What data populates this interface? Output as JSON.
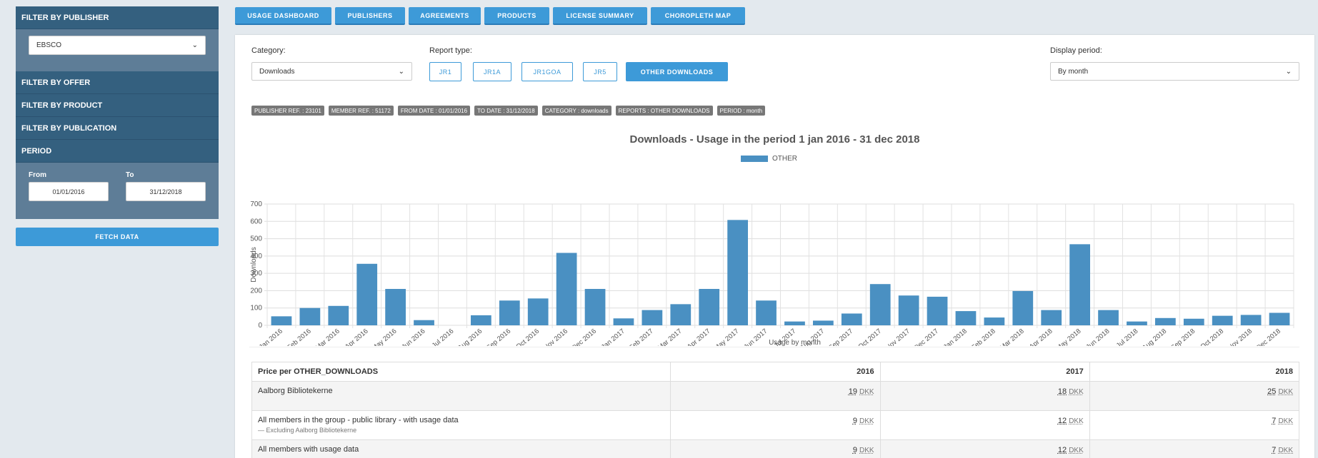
{
  "sidebar": {
    "filter_publisher": "FILTER BY PUBLISHER",
    "publisher_value": "EBSCO",
    "filter_offer": "FILTER BY OFFER",
    "filter_product": "FILTER BY PRODUCT",
    "filter_publication": "FILTER BY PUBLICATION",
    "period": "PERIOD",
    "from_label": "From",
    "to_label": "To",
    "from_value": "01/01/2016",
    "to_value": "31/12/2018",
    "fetch": "FETCH DATA"
  },
  "nav": [
    "USAGE DASHBOARD",
    "PUBLISHERS",
    "AGREEMENTS",
    "PRODUCTS",
    "LICENSE SUMMARY",
    "CHOROPLETH MAP"
  ],
  "controls": {
    "category_label": "Category:",
    "category_value": "Downloads",
    "report_label": "Report type:",
    "report_types": [
      "JR1",
      "JR1A",
      "JR1GOA",
      "JR5",
      "OTHER DOWNLOADS"
    ],
    "active_report": "OTHER DOWNLOADS",
    "period_label": "Display period:",
    "period_value": "By month"
  },
  "badges": [
    "PUBLISHER REF. : 23101",
    "MEMBER REF. : 51172",
    "FROM DATE : 01/01/2016",
    "TO DATE : 31/12/2018",
    "CATEGORY : downloads",
    "REPORTS : OTHER DOWNLOADS",
    "PERIOD : month"
  ],
  "chart_data": {
    "type": "bar",
    "title": "Downloads - Usage in the period 1 jan 2016 - 31 dec 2018",
    "xlabel": "Usage by month",
    "ylabel": "Downloads",
    "ylim": [
      0,
      700
    ],
    "yticks": [
      0,
      100,
      200,
      300,
      400,
      500,
      600,
      700
    ],
    "grid": true,
    "legend_position": "top-center",
    "color": "#4a90c2",
    "categories": [
      "Jan 2016",
      "Feb 2016",
      "Mar 2016",
      "Apr 2016",
      "May 2016",
      "Jun 2016",
      "Jul 2016",
      "Aug 2016",
      "Sep 2016",
      "Oct 2016",
      "Nov 2016",
      "Dec 2016",
      "Jan 2017",
      "Feb 2017",
      "Mar 2017",
      "Apr 2017",
      "May 2017",
      "Jun 2017",
      "Jul 2017",
      "Aug 2017",
      "Sep 2017",
      "Oct 2017",
      "Nov 2017",
      "Dec 2017",
      "Jan 2018",
      "Feb 2018",
      "Mar 2018",
      "Apr 2018",
      "May 2018",
      "Jun 2018",
      "Jul 2018",
      "Aug 2018",
      "Sep 2018",
      "Oct 2018",
      "Nov 2018",
      "Dec 2018"
    ],
    "series": [
      {
        "name": "OTHER",
        "values": [
          52,
          100,
          112,
          355,
          210,
          30,
          0,
          58,
          143,
          155,
          418,
          210,
          40,
          88,
          122,
          210,
          608,
          143,
          22,
          27,
          68,
          238,
          172,
          165,
          82,
          45,
          198,
          88,
          468,
          88,
          22,
          42,
          38,
          55,
          60,
          72
        ]
      }
    ]
  },
  "table": {
    "header": [
      "Price per OTHER_DOWNLOADS",
      "2016",
      "2017",
      "2018"
    ],
    "currency": "DKK",
    "rows": [
      {
        "name": "Aalborg Bibliotekerne",
        "note": "",
        "values": [
          "19",
          "18",
          "25"
        ]
      },
      {
        "name": "All members in the group - public library - with usage data",
        "note": "— Excluding Aalborg Bibliotekerne",
        "values": [
          "9",
          "12",
          "7"
        ]
      },
      {
        "name": "All members with usage data",
        "note": "",
        "values": [
          "9",
          "12",
          "7"
        ]
      }
    ]
  }
}
